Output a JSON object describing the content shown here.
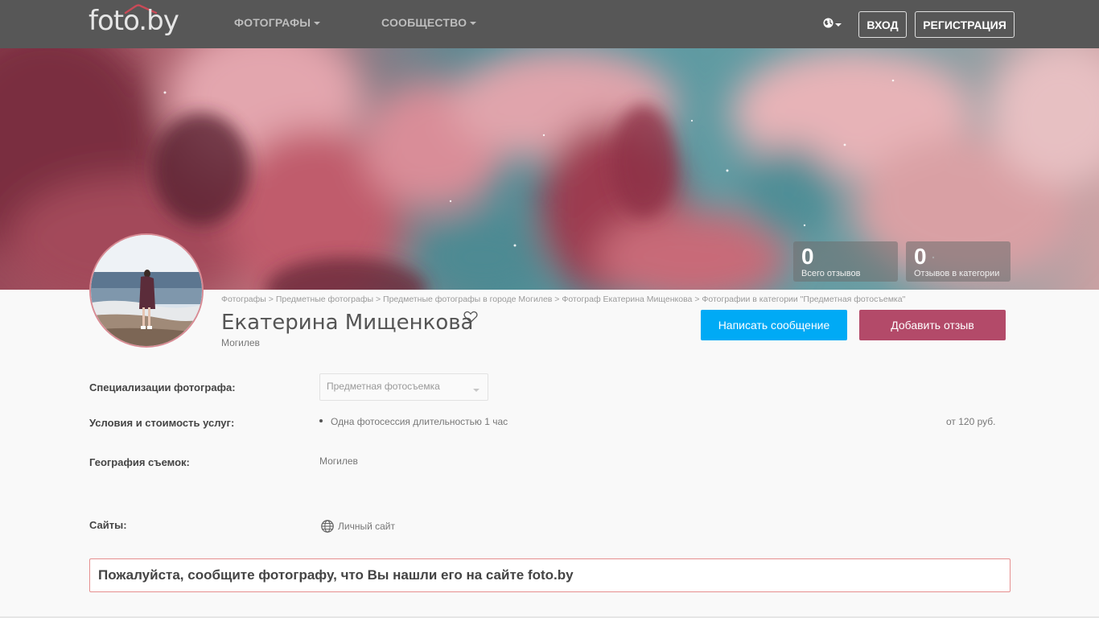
{
  "header": {
    "logo": "foto.by",
    "nav": [
      {
        "label": "ФОТОГРАФЫ"
      },
      {
        "label": "СООБЩЕСТВО"
      }
    ],
    "login": "ВХОД",
    "register": "РЕГИСТРАЦИЯ"
  },
  "stats": [
    {
      "value": "0",
      "label": "Всего отзывов"
    },
    {
      "value": "0",
      "label": "Отзывов в категории"
    }
  ],
  "breadcrumb": [
    "Фотографы",
    "Предметные фотографы",
    "Предметные фотографы в городе Могилев",
    "Фотограф Екатерина Мищенкова",
    "Фотографии в категории \"Предметная фотосъемка\""
  ],
  "breadcrumb_separator": ">",
  "profile": {
    "name": "Екатерина Мищенкова",
    "city": "Могилев",
    "message_button": "Написать сообщение",
    "review_button": "Добавить отзыв"
  },
  "info": {
    "specializations_label": "Специализации фотографа:",
    "specialization_selected": "Предметная фотосъемка",
    "services_label": "Условия и стоимость услуг:",
    "service_name": "Одна фотосессия длительностью 1 час",
    "service_price": "от 120 руб.",
    "geography_label": "География съемок:",
    "geography_value": "Могилев",
    "sites_label": "Сайты:",
    "site_link": "Личный сайт"
  },
  "notice": "Пожалуйста, сообщите фотографу, что Вы нашли его на сайте foto.by",
  "colors": {
    "header_bg": "#575757",
    "message_button": "#00aaf5",
    "review_button": "#b34a69",
    "notice_border": "#e58f8f"
  }
}
